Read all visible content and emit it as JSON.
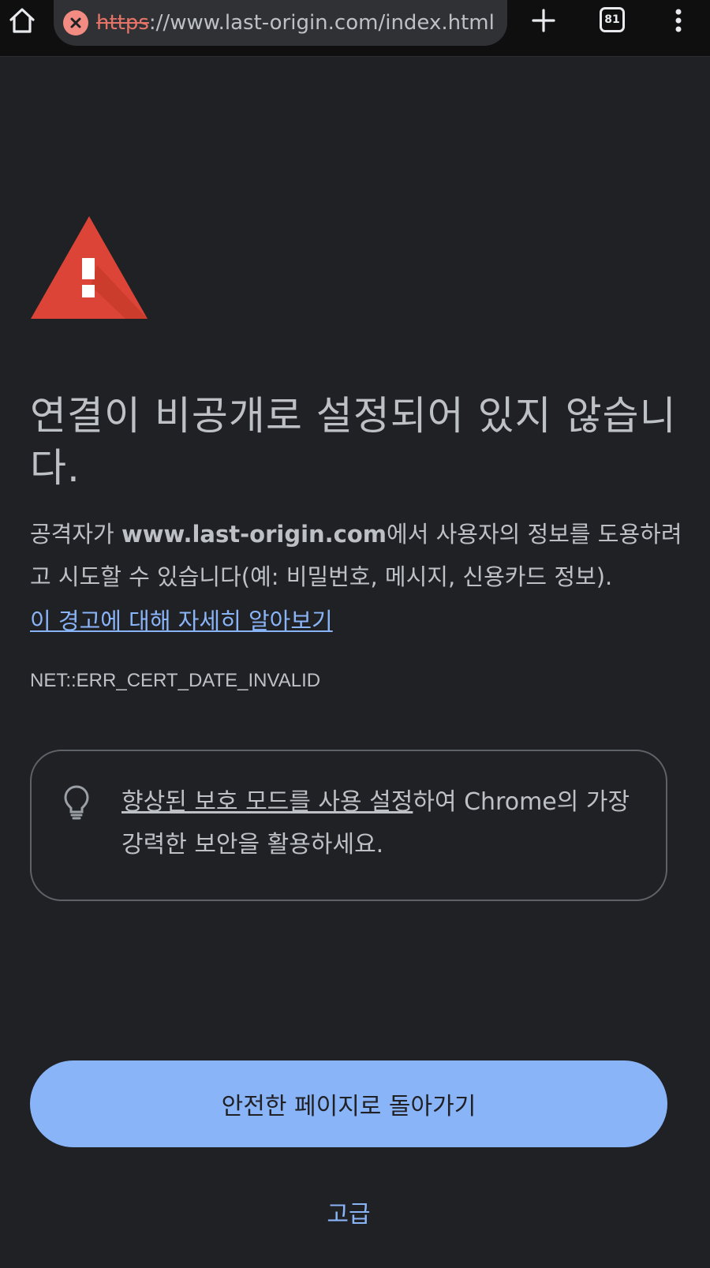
{
  "browser": {
    "url_scheme": "https",
    "url_rest": "://www.last-origin.com/index.html",
    "tab_count": "81"
  },
  "interstitial": {
    "headline": "연결이 비공개로 설정되어 있지 않습니다.",
    "msg_prefix": "공격자가 ",
    "msg_domain": "www.last-origin.com",
    "msg_suffix": "에서 사용자의 정보를 도용하려고 시도할 수 있습니다(예: 비밀번호, 메시지, 신용카드 정보).",
    "learn_more": "이 경고에 대해 자세히 알아보기",
    "error_code": "NET::ERR_CERT_DATE_INVALID",
    "enhanced_link": "향상된 보호 모드를 사용 설정",
    "enhanced_rest": "하여 Chrome의 가장 강력한 보안을 활용하세요.",
    "back_button": "안전한 페이지로 돌아가기",
    "advanced_button": "고급"
  },
  "colors": {
    "background": "#202124",
    "accent": "#8ab4f8",
    "warning": "#db4437"
  },
  "icons": [
    "home-icon",
    "alert-icon",
    "plus-icon",
    "tabs-icon",
    "more-vert-icon",
    "warning-triangle-icon",
    "lightbulb-icon"
  ]
}
